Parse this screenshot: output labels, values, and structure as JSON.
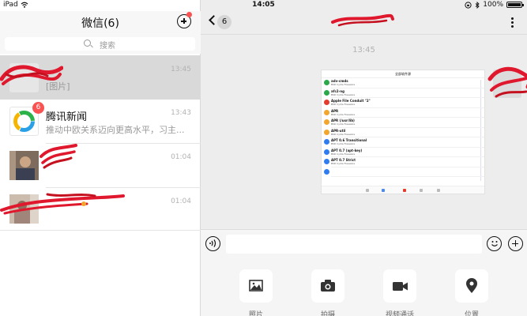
{
  "status_bar": {
    "device": "iPad",
    "time": "14:05",
    "battery": "100%"
  },
  "left_pane": {
    "title": "微信(6)",
    "search_placeholder": "搜索",
    "chats": [
      {
        "name": "",
        "preview": "[图片]",
        "time": "13:45",
        "badge": ""
      },
      {
        "name": "腾讯新闻",
        "preview": "推动中欧关系迈向更高水平，习主...",
        "time": "13:43",
        "badge": "6"
      },
      {
        "name": "",
        "preview": "",
        "time": "01:04",
        "badge": ""
      },
      {
        "name": "",
        "preview": "",
        "time": "01:04",
        "badge": ""
      }
    ]
  },
  "right_pane": {
    "back_count": "6",
    "message_time": "13:45",
    "screenshot_title": "全部软件源",
    "screenshot_rows": [
      {
        "title": "adv-cmds",
        "sub": "BSD Cydia Freeware",
        "color": "#2aa84a"
      },
      {
        "title": "afc2-ng",
        "sub": "BSD Cydia Freeware",
        "color": "#2aa84a"
      },
      {
        "title": "Apple File Conduit \"2\"",
        "sub": "BSD Cydia Freeware",
        "color": "#e33b2e"
      },
      {
        "title": "APR",
        "sub": "BSD Cydia Freeware",
        "color": "#f2a62d"
      },
      {
        "title": "APR (/usr/lib)",
        "sub": "BSD Cydia Freeware",
        "color": "#f2a62d"
      },
      {
        "title": "APR-util",
        "sub": "BSD Cydia Freeware",
        "color": "#f2a62d"
      },
      {
        "title": "APT 0.6 Transitional",
        "sub": "BSD Cydia Freeware",
        "color": "#2f7cf0"
      },
      {
        "title": "APT 0.7 (apt-key)",
        "sub": "BSD Cydia Freeware",
        "color": "#2f7cf0"
      },
      {
        "title": "APT 0.7 Strict",
        "sub": "BSD Cydia Freeware",
        "color": "#2f7cf0"
      },
      {
        "title": "",
        "sub": "",
        "color": "#2f7cf0"
      }
    ],
    "tools": [
      {
        "label": "照片",
        "icon": "photo-icon"
      },
      {
        "label": "拍摄",
        "icon": "camera-icon"
      },
      {
        "label": "视频通话",
        "icon": "video-call-icon"
      },
      {
        "label": "位置",
        "icon": "location-icon"
      }
    ]
  }
}
